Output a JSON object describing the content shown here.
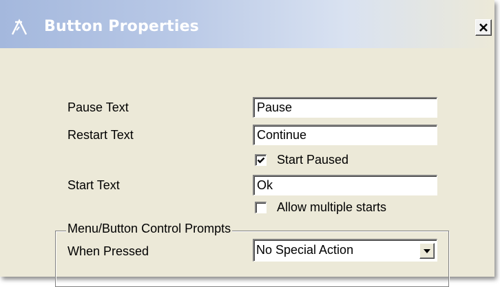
{
  "window": {
    "title": "Button Properties",
    "title_icon": "app-triangle-icon",
    "close_icon": "close-icon",
    "colors": {
      "titlebar_start": "#a4b8dd",
      "titlebar_end": "#ece9d8",
      "background": "#ece9d8"
    }
  },
  "form": {
    "pause_label": "Pause Text",
    "pause_value": "Pause",
    "restart_label": "Restart Text",
    "restart_value": "Continue",
    "start_paused_label": "Start Paused",
    "start_paused_checked": true,
    "start_label": "Start Text",
    "start_value": "Ok",
    "allow_multiple_label": "Allow multiple starts",
    "allow_multiple_checked": false
  },
  "group": {
    "title": "Menu/Button Control Prompts",
    "when_pressed_label": "When Pressed",
    "when_pressed_value": "No Special Action",
    "dropdown_icon": "chevron-down-icon"
  }
}
